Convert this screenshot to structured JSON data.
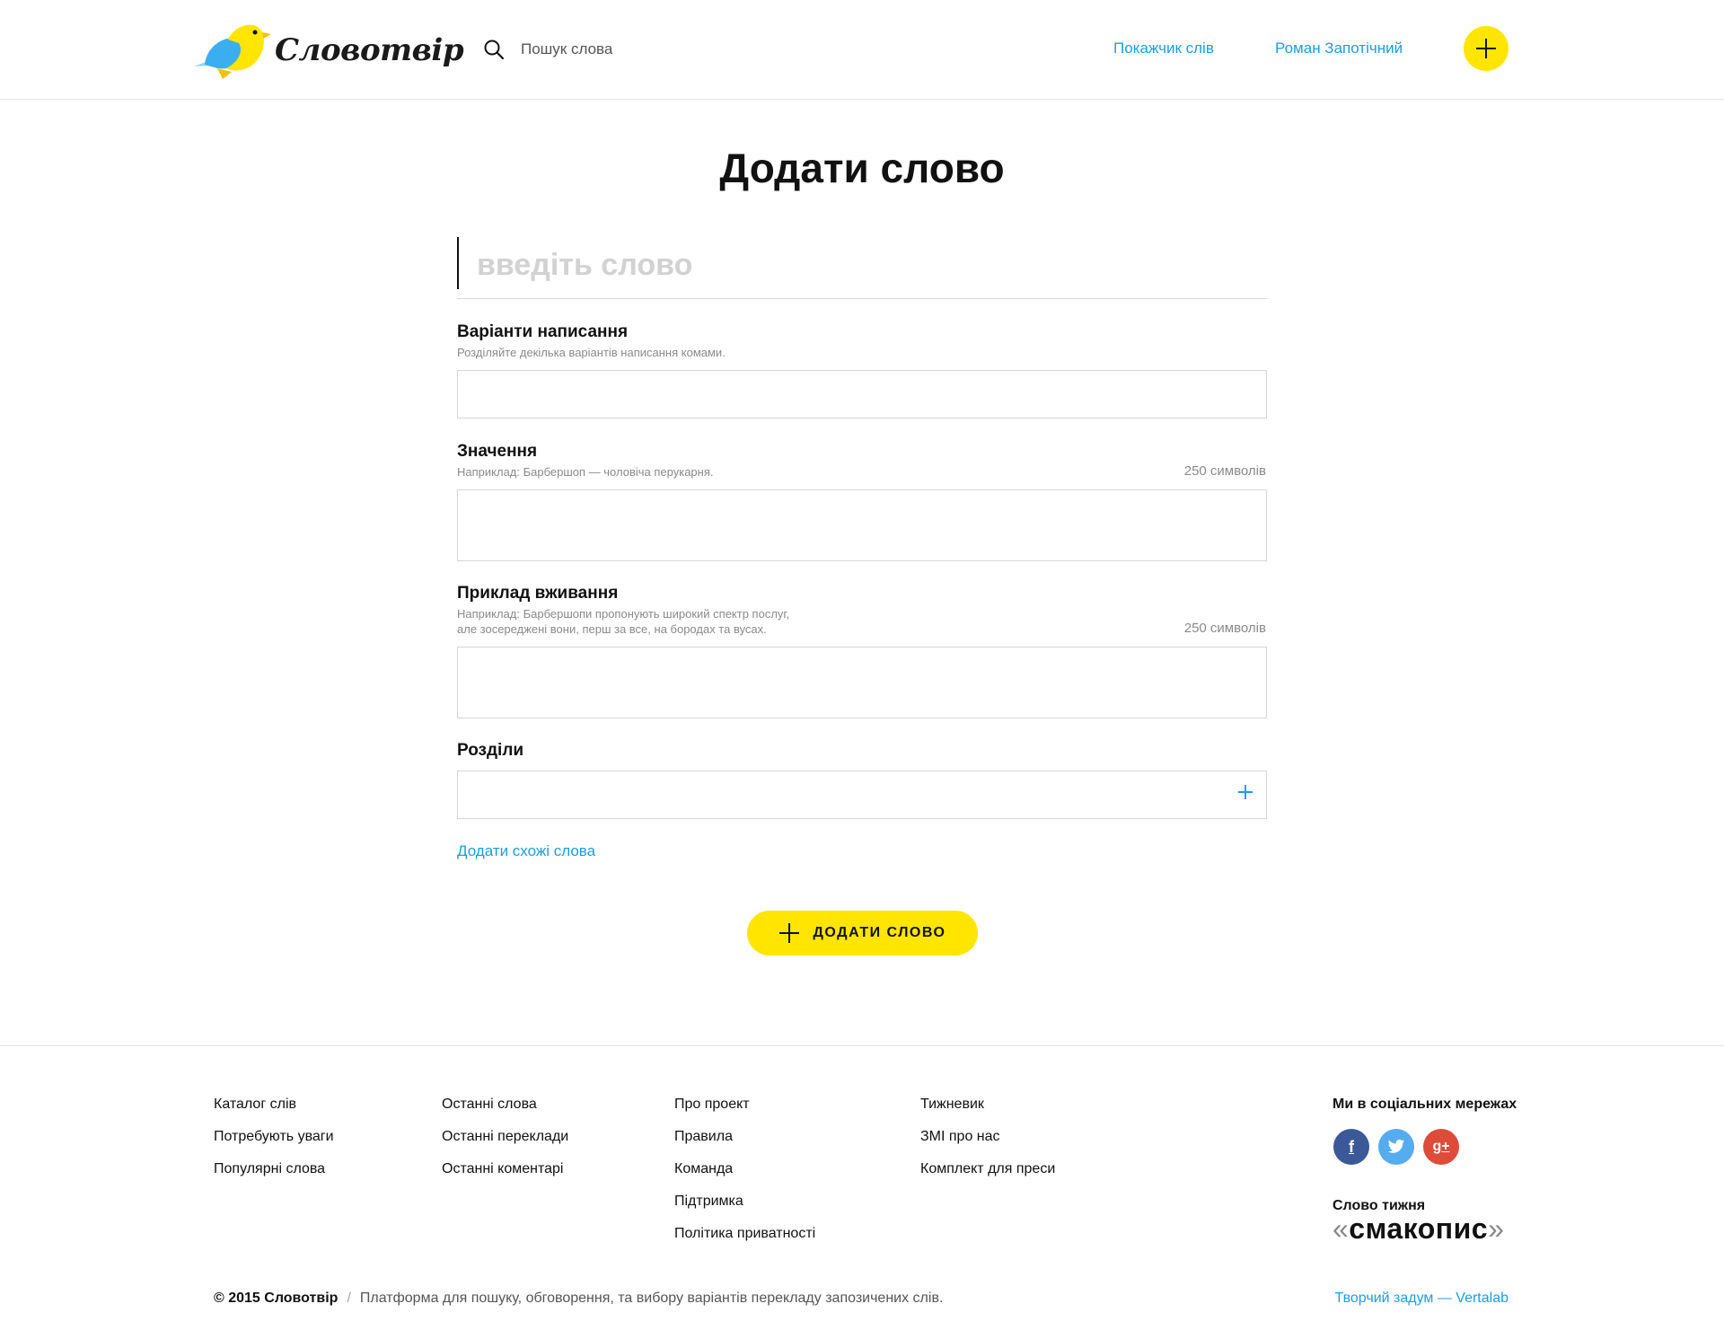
{
  "header": {
    "logo_text": "Словотвір",
    "search_placeholder": "Пошук слова",
    "nav": {
      "index": "Покажчик слів",
      "user": "Роман Запотічний"
    }
  },
  "form": {
    "title": "Додати слово",
    "word_placeholder": "введіть слово",
    "spellings": {
      "label": "Варіанти написання",
      "hint": "Розділяйте декілька варіантів написання комами."
    },
    "meaning": {
      "label": "Значення",
      "hint": "Наприклад: Барбершоп — чоловіча перукарня.",
      "count": "250 символів"
    },
    "example": {
      "label": "Приклад вживання",
      "hint1": "Наприклад: Барбершопи пропонують широкий спектр послуг,",
      "hint2": "але зосереджені вони, перш за все, на бородах та вусах.",
      "count": "250 символів"
    },
    "sections": {
      "label": "Розділи"
    },
    "similar_link": "Додати схожі слова",
    "submit": "ДОДАТИ СЛОВО"
  },
  "footer": {
    "col1": [
      "Каталог слів",
      "Потребують уваги",
      "Популярні слова"
    ],
    "col2": [
      "Останні слова",
      "Останні переклади",
      "Останні коментарі"
    ],
    "col3": [
      "Про проект",
      "Правила",
      "Команда",
      "Підтримка",
      "Політика приватності"
    ],
    "col4": [
      "Тижневик",
      "ЗМІ про нас",
      "Комплект для преси"
    ],
    "social_title": "Ми в соціальних мережах",
    "social_icons": {
      "facebook": "f",
      "googleplus": "g+"
    },
    "word_of_week_title": "Слово тижня",
    "word_of_week": "смакопис",
    "copyright": "© 2015 Словотвір",
    "separator": "/",
    "description": "Платформа для пошуку, обговорення, та вибору варіантів перекладу запозичених слів.",
    "credit": "Творчий задум — Vertalab"
  },
  "colors": {
    "accent_yellow": "#ffe500",
    "link_blue": "#1c9de2",
    "facebook": "#3b5998",
    "twitter": "#55acee",
    "googleplus": "#dd4b39"
  }
}
